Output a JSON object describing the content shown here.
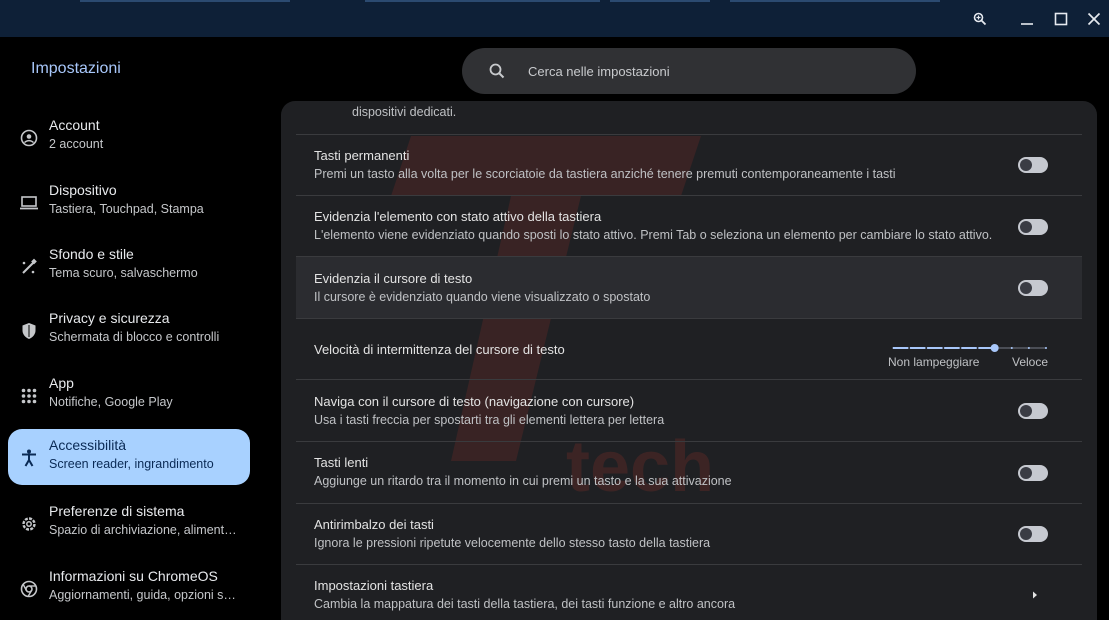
{
  "window": {
    "buttons": [
      "zoom",
      "minimize",
      "maximize",
      "close"
    ]
  },
  "header": {
    "app_title": "Impostazioni",
    "search_placeholder": "Cerca nelle impostazioni"
  },
  "sidebar": {
    "items": [
      {
        "title": "Account",
        "subtitle": "2 account",
        "icon": "account-icon",
        "active": false
      },
      {
        "title": "Dispositivo",
        "subtitle": "Tastiera, Touchpad, Stampa",
        "icon": "laptop-icon",
        "active": false
      },
      {
        "title": "Sfondo e stile",
        "subtitle": "Tema scuro, salvaschermo",
        "icon": "paintbrush-icon",
        "active": false
      },
      {
        "title": "Privacy e sicurezza",
        "subtitle": "Schermata di blocco e controlli",
        "icon": "shield-icon",
        "active": false
      },
      {
        "title": "App",
        "subtitle": "Notifiche, Google Play",
        "icon": "apps-grid-icon",
        "active": false
      },
      {
        "title": "Accessibilità",
        "subtitle": "Screen reader, ingrandimento",
        "icon": "accessibility-icon",
        "active": true
      },
      {
        "title": "Preferenze di sistema",
        "subtitle": "Spazio di archiviazione, aliment…",
        "icon": "gear-icon",
        "active": false
      },
      {
        "title": "Informazioni su ChromeOS",
        "subtitle": "Aggiornamenti, guida, opzioni s…",
        "icon": "chromeos-icon",
        "active": false
      }
    ]
  },
  "content": {
    "partial_top_text": "dispositivi dedicati.",
    "rows": [
      {
        "title": "Tasti permanenti",
        "description": "Premi un tasto alla volta per le scorciatoie da tastiera anziché tenere premuti contemporaneamente i tasti",
        "control": "toggle",
        "on": false
      },
      {
        "title": "Evidenzia l'elemento con stato attivo della tastiera",
        "description": "L'elemento viene evidenziato quando sposti lo stato attivo. Premi Tab o seleziona un elemento per cambiare lo stato attivo.",
        "control": "toggle",
        "on": false
      },
      {
        "title": "Evidenzia il cursore di testo",
        "description": "Il cursore è evidenziato quando viene visualizzato o spostato",
        "control": "toggle",
        "on": false
      },
      {
        "title": "Velocità di intermittenza del cursore di testo",
        "description": "",
        "control": "slider",
        "slider": {
          "min_label": "Non lampeggiare",
          "max_label": "Veloce",
          "steps": 10,
          "value_step": 6
        }
      },
      {
        "title": "Naviga con il cursore di testo (navigazione con cursore)",
        "description": "Usa i tasti freccia per spostarti tra gli elementi lettera per lettera",
        "control": "toggle",
        "on": false
      },
      {
        "title": "Tasti lenti",
        "description": "Aggiunge un ritardo tra il momento in cui premi un tasto e la sua attivazione",
        "control": "toggle",
        "on": false
      },
      {
        "title": "Antirimbalzo dei tasti",
        "description": "Ignora le pressioni ripetute velocemente dello stesso tasto della tastiera",
        "control": "toggle",
        "on": false
      },
      {
        "title": "Impostazioni tastiera",
        "description": "Cambia la mappatura dei tasti della tastiera, dei tasti funzione e altro ancora",
        "control": "link"
      }
    ]
  },
  "colors": {
    "accent": "#a8c7fa",
    "active_nav_bg": "#a8d1ff",
    "card_bg": "#1f2023",
    "watermark": "#c0392b"
  },
  "watermark_text": "tech"
}
